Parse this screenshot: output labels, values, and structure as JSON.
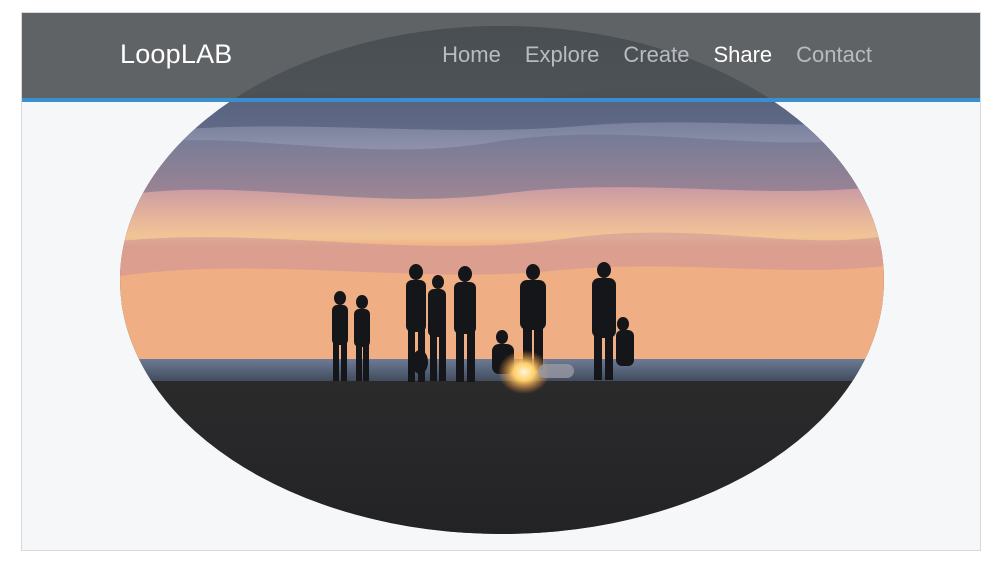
{
  "navbar": {
    "brand": "LoopLAB",
    "links": [
      {
        "label": "Home",
        "active": false
      },
      {
        "label": "Explore",
        "active": false
      },
      {
        "label": "Create",
        "active": false
      },
      {
        "label": "Share",
        "active": true
      },
      {
        "label": "Contact",
        "active": false
      }
    ],
    "accent_color": "#3a8fcf"
  },
  "hero": {
    "image_subject": "people-at-beach-bonfire-sunset",
    "shape": "ellipse"
  }
}
